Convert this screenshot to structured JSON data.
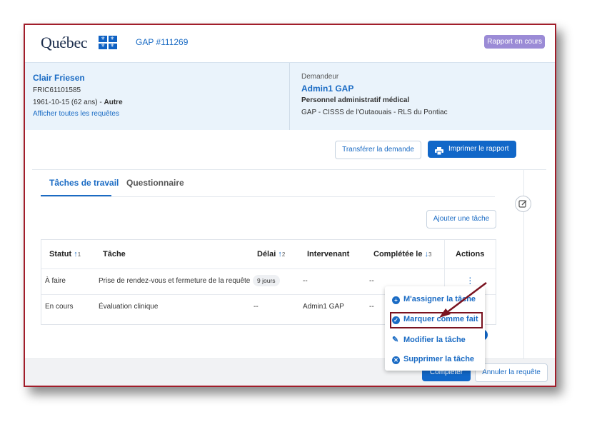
{
  "header": {
    "logo_text": "Québec",
    "request_id": "GAP #111269",
    "status_badge": "Rapport en cours"
  },
  "patient": {
    "name": "Clair Friesen",
    "code": "FRIC61101585",
    "dob_age": "1961-10-15 (62 ans) - ",
    "sex": "Autre",
    "link_all_requests": "Afficher toutes les requêtes"
  },
  "requester": {
    "label": "Demandeur",
    "name": "Admin1 GAP",
    "role": "Personnel administratif médical",
    "org": "GAP - CISSS de l'Outaouais - RLS du Pontiac"
  },
  "toolbar": {
    "transfer_label": "Transférer la demande",
    "print_label": "Imprimer le rapport"
  },
  "tabs": [
    {
      "label": "Tâches de travail"
    },
    {
      "label": "Questionnaire"
    }
  ],
  "add_task_label": "Ajouter une tâche",
  "table": {
    "headers": {
      "status": "Statut",
      "status_sort_num": "1",
      "task": "Tâche",
      "delay": "Délai",
      "delay_sort_num": "2",
      "worker": "Intervenant",
      "completed": "Complétée le",
      "completed_sort_num": "3",
      "actions": "Actions"
    },
    "rows": [
      {
        "status": "À faire",
        "task": "Prise de rendez-vous et fermeture de la requête",
        "delay": "9 jours",
        "worker": "--",
        "completed": "--"
      },
      {
        "status": "En cours",
        "task": "Évaluation clinique",
        "delay": "--",
        "worker": "Admin1 GAP",
        "completed": "--"
      }
    ]
  },
  "context_menu": {
    "items": [
      {
        "label": "M'assigner la tâche",
        "icon": "plus-circle-icon"
      },
      {
        "label": "Marquer comme fait",
        "icon": "check-circle-icon"
      },
      {
        "label": "Modifier la tâche",
        "icon": "pencil-icon"
      },
      {
        "label": "Supprimer la tâche",
        "icon": "x-circle-icon"
      }
    ]
  },
  "footer": {
    "complete_label": "Compléter",
    "cancel_label": "Annuler la requête"
  },
  "colors": {
    "accent": "#1a6bc4",
    "primary_button": "#1167c8",
    "badge": "#9b8bd6",
    "highlight_border": "#7a1320"
  }
}
